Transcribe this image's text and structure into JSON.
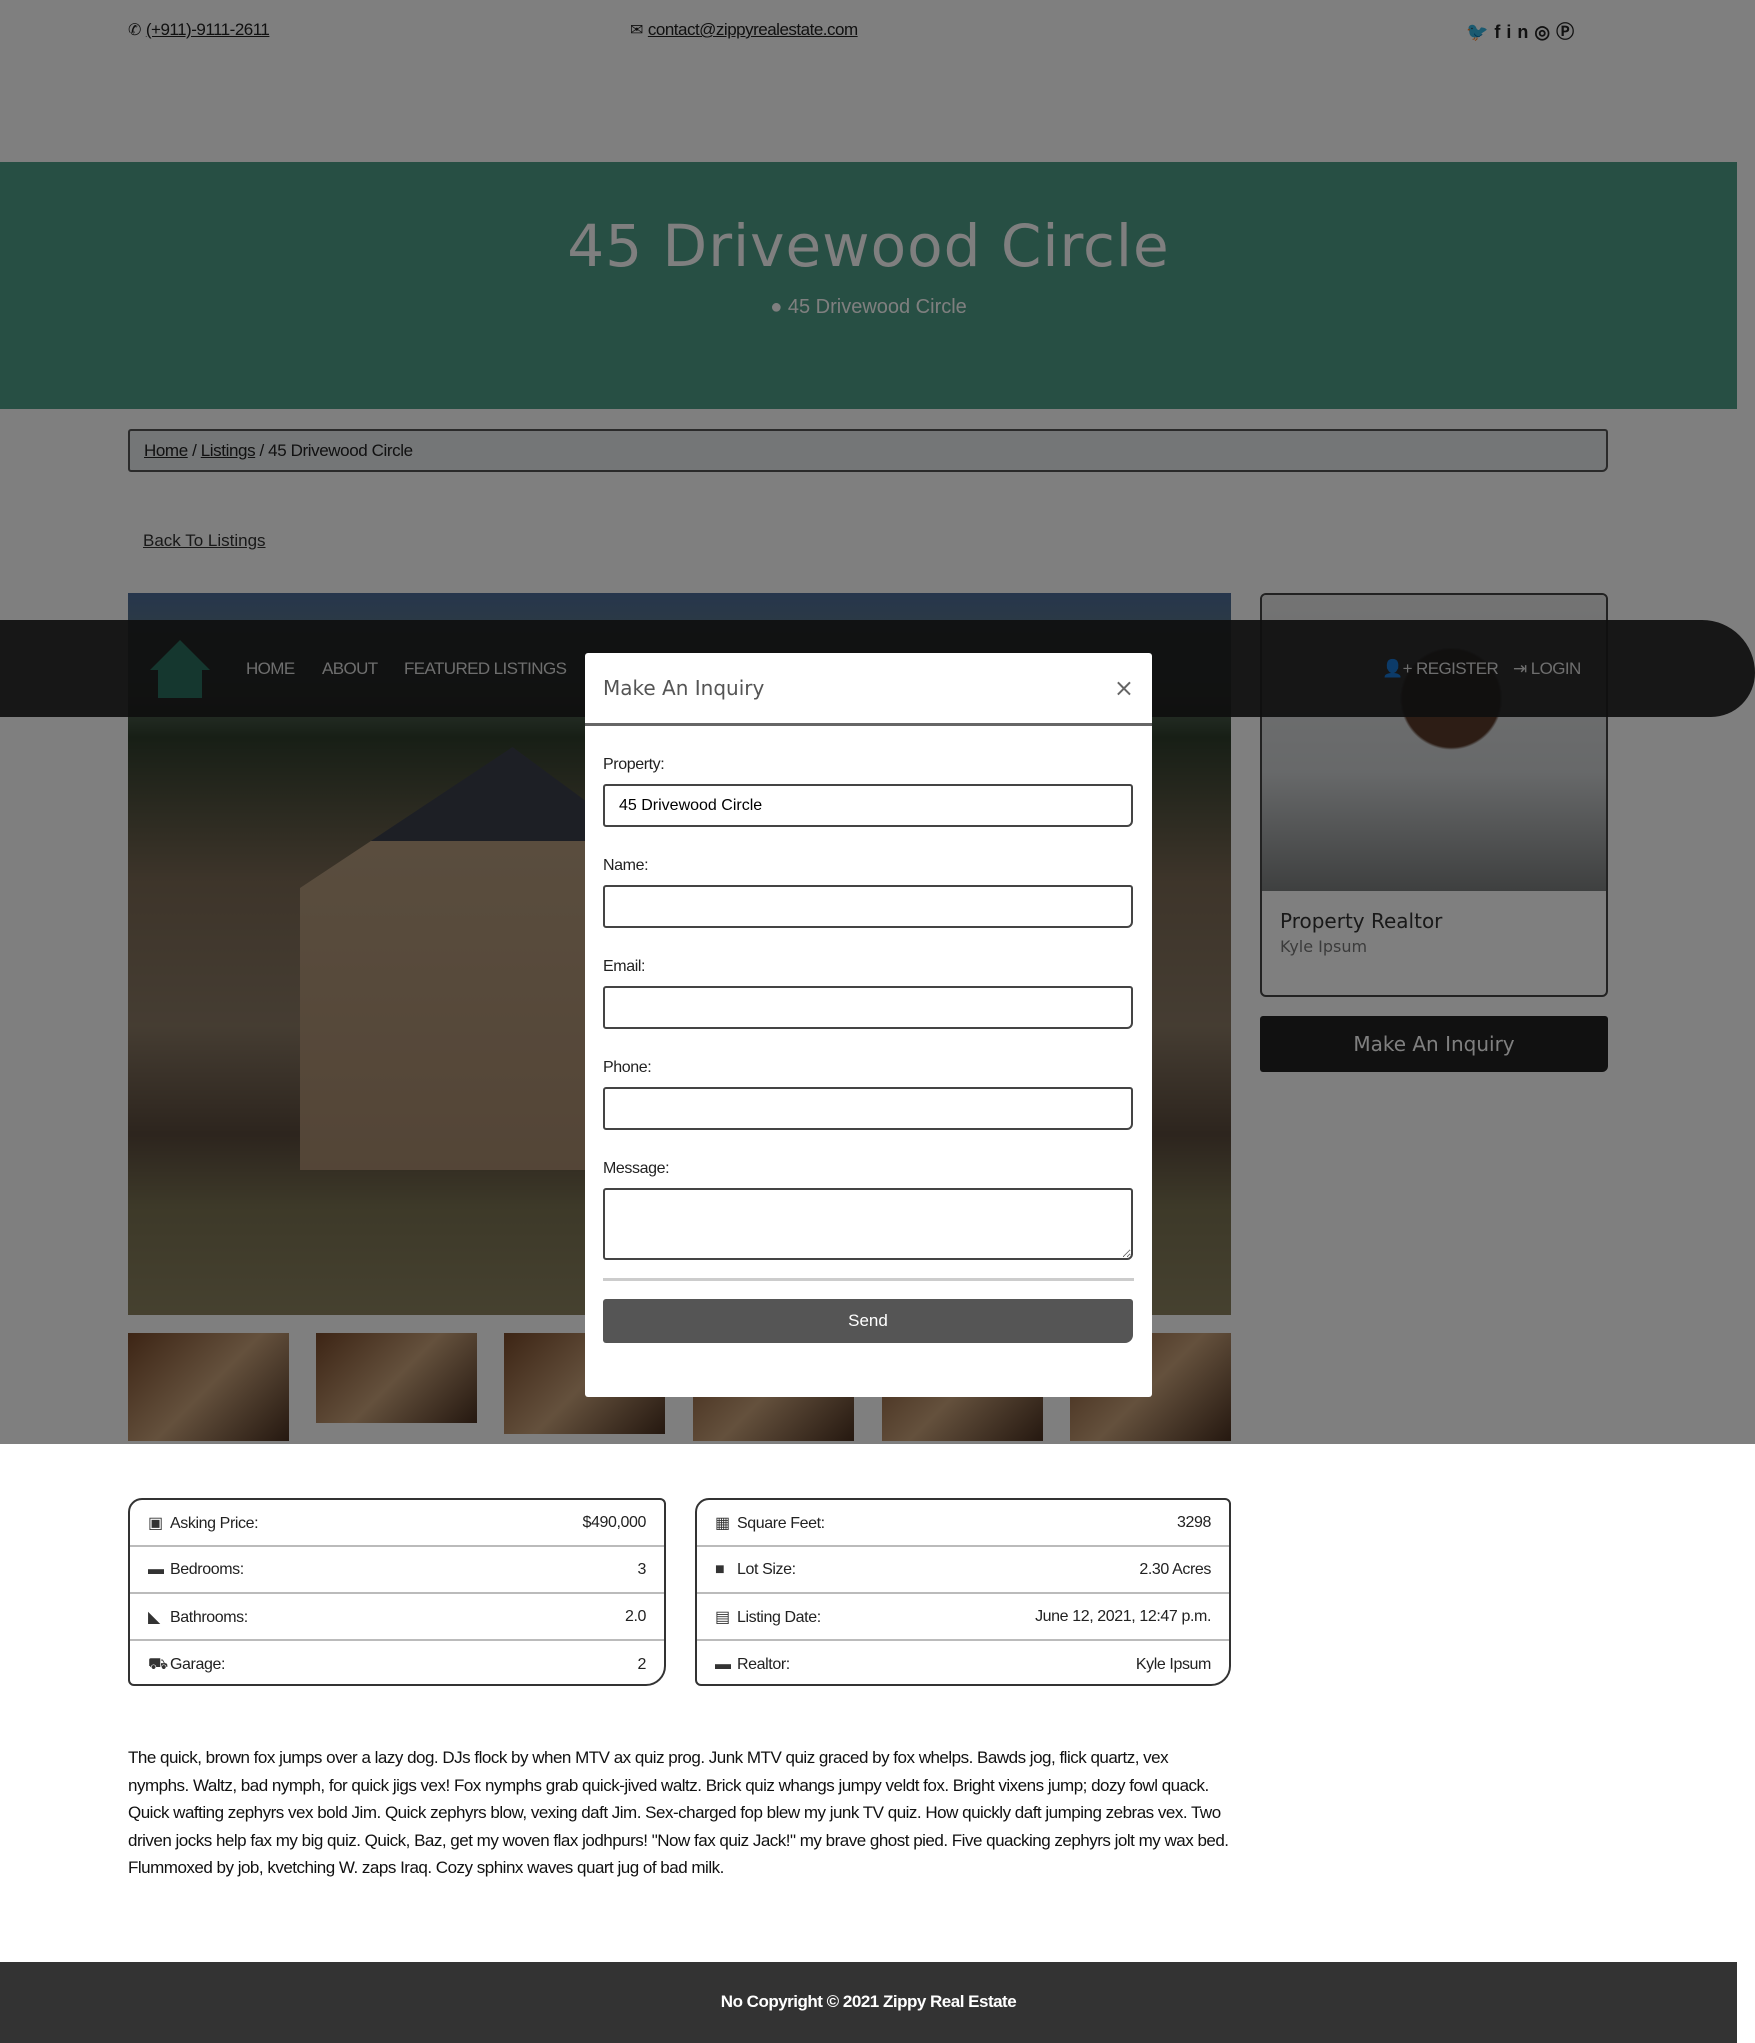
{
  "topbar": {
    "phone": "(+911)-9111-2611",
    "email": "contact@zippyrealestate.com",
    "social_icons": [
      "twitter-icon",
      "facebook-icon",
      "linkedin-icon",
      "instagram-icon",
      "pinterest-icon"
    ]
  },
  "hero": {
    "title": "45 Drivewood Circle",
    "address": "45 Drivewood Circle",
    "color": "#4e9f89"
  },
  "breadcrumb": {
    "home": "Home",
    "listings": "Listings",
    "current": "45 Drivewood Circle"
  },
  "back_link": "Back To Listings",
  "navbar": {
    "home": "HOME",
    "about": "ABOUT",
    "featured": "FEATURED LISTINGS",
    "register": "REGISTER",
    "login": "LOGIN"
  },
  "realtor_card": {
    "title": "Property Realtor",
    "name": "Kyle Ipsum"
  },
  "inquiry_button": "Make An Inquiry",
  "modal": {
    "title": "Make An Inquiry",
    "close": "×",
    "property_label": "Property:",
    "property_value": "45 Drivewood Circle",
    "name_label": "Name:",
    "email_label": "Email:",
    "phone_label": "Phone:",
    "message_label": "Message:",
    "send": "Send"
  },
  "details_left": [
    {
      "icon": "money-icon",
      "label": "Asking Price:",
      "value": "$490,000"
    },
    {
      "icon": "bed-icon",
      "label": "Bedrooms:",
      "value": "3"
    },
    {
      "icon": "bath-icon",
      "label": "Bathrooms:",
      "value": "2.0"
    },
    {
      "icon": "car-icon",
      "label": "Garage:",
      "value": "2"
    }
  ],
  "details_right": [
    {
      "icon": "grid-icon",
      "label": "Square Feet:",
      "value": "3298"
    },
    {
      "icon": "square-icon",
      "label": "Lot Size:",
      "value": "2.30 Acres"
    },
    {
      "icon": "calendar-icon",
      "label": "Listing Date:",
      "value": "June 12, 2021, 12:47 p.m."
    },
    {
      "icon": "bed-icon",
      "label": "Realtor:",
      "value": "Kyle Ipsum"
    }
  ],
  "description": "The quick, brown fox jumps over a lazy dog. DJs flock by when MTV ax quiz prog. Junk MTV quiz graced by fox whelps. Bawds jog, flick quartz, vex nymphs. Waltz, bad nymph, for quick jigs vex! Fox nymphs grab quick-jived waltz. Brick quiz whangs jumpy veldt fox. Bright vixens jump; dozy fowl quack. Quick wafting zephyrs vex bold Jim. Quick zephyrs blow, vexing daft Jim. Sex-charged fop blew my junk TV quiz. How quickly daft jumping zebras vex. Two driven jocks help fax my big quiz. Quick, Baz, get my woven flax jodhpurs! \"Now fax quiz Jack!\" my brave ghost pied. Five quacking zephyrs jolt my wax bed. Flummoxed by job, kvetching W. zaps Iraq. Cozy sphinx waves quart jug of bad milk.",
  "footer": "No Copyright © 2021 Zippy Real Estate"
}
